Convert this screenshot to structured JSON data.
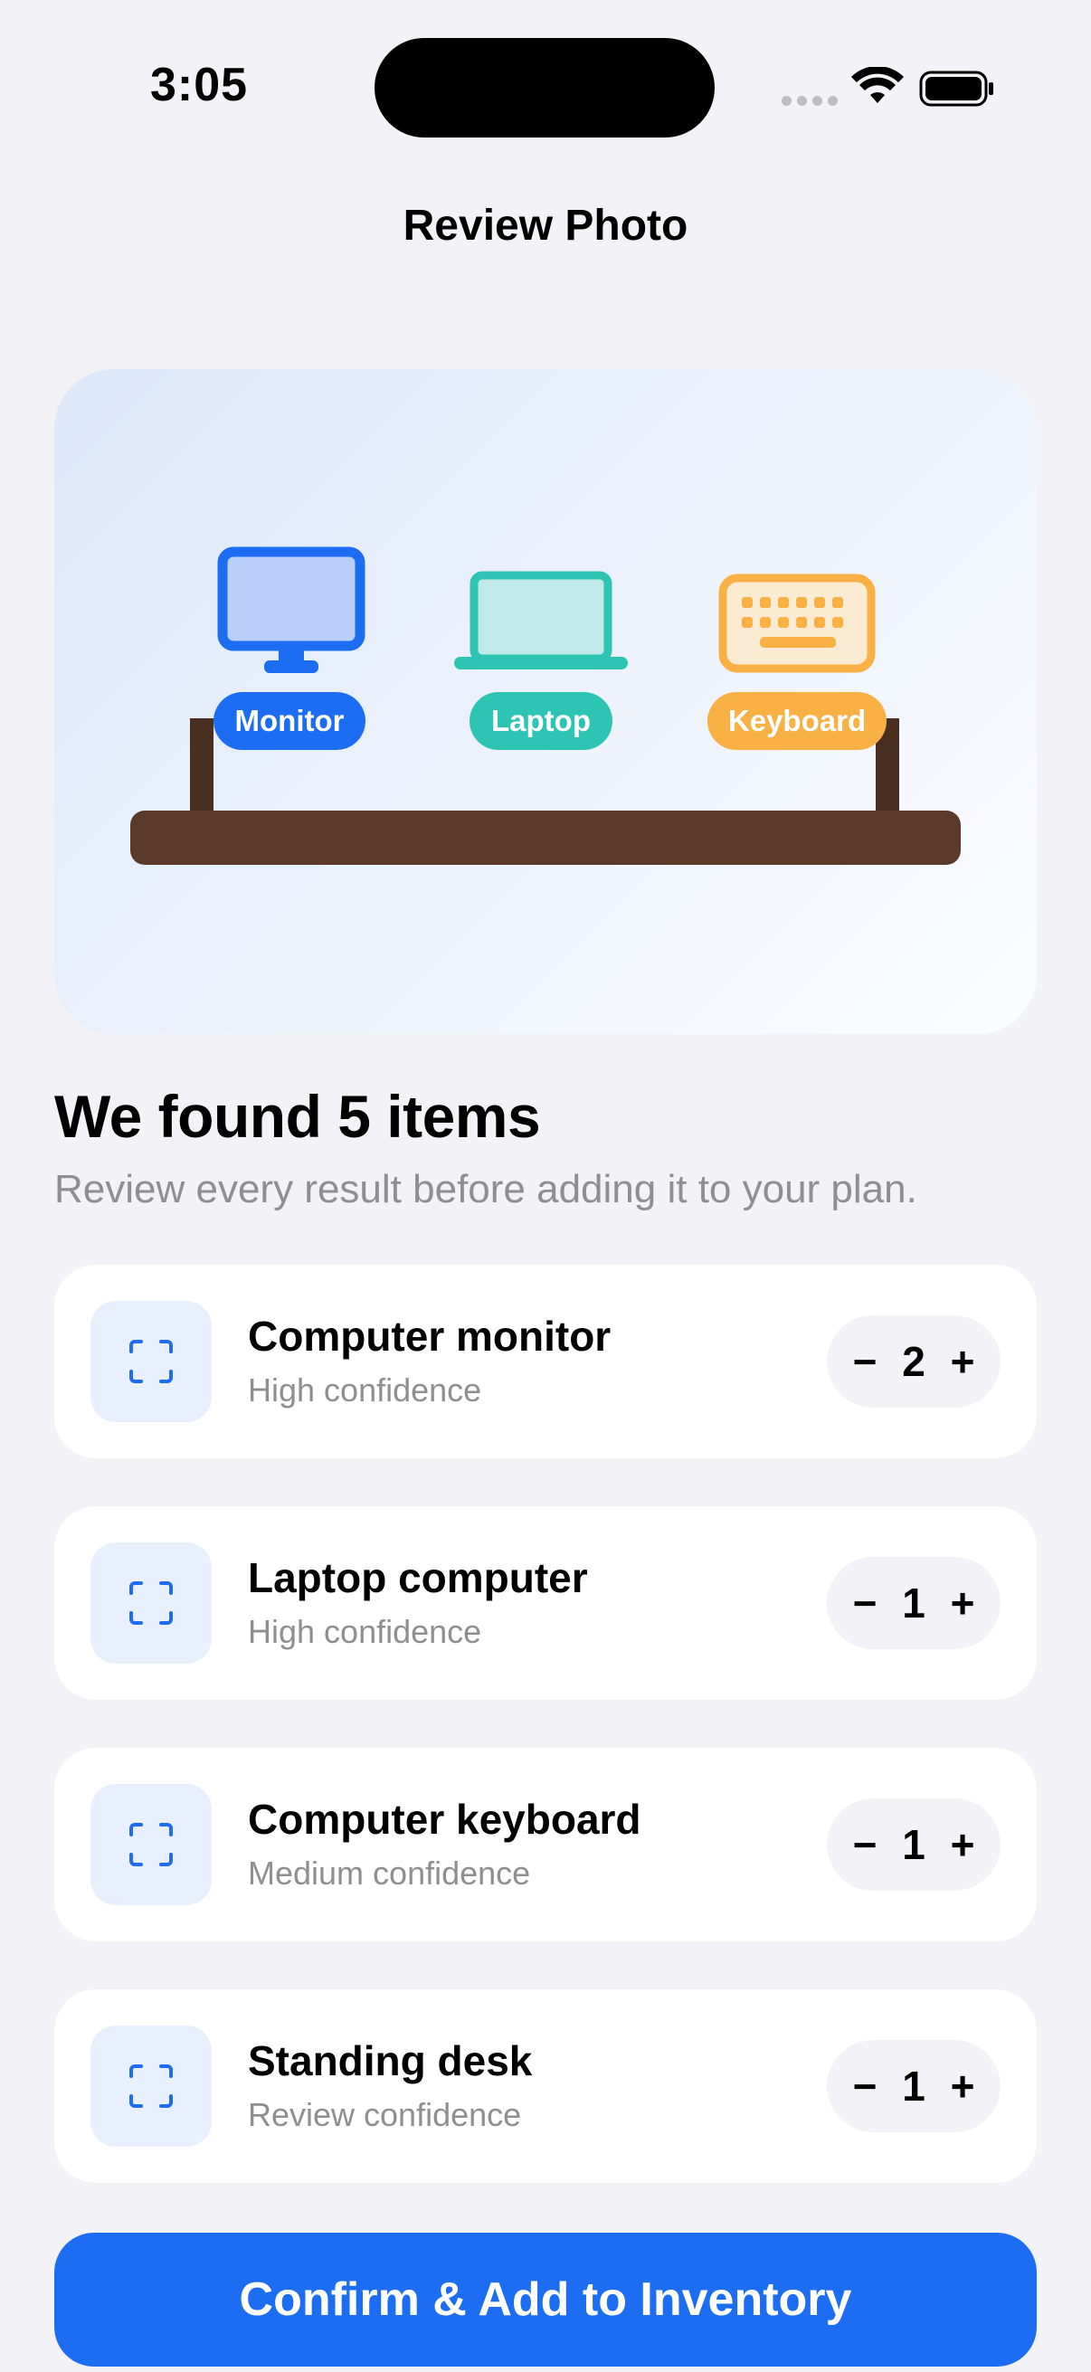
{
  "status_bar": {
    "time": "3:05"
  },
  "nav": {
    "title": "Review Photo"
  },
  "photo": {
    "labels": {
      "monitor": "Monitor",
      "laptop": "Laptop",
      "keyboard": "Keyboard"
    }
  },
  "results": {
    "heading": "We found 5 items",
    "subtitle": "Review every result before adding it to your plan."
  },
  "items": [
    {
      "name": "Computer monitor",
      "confidence": "High confidence",
      "quantity": "2"
    },
    {
      "name": "Laptop computer",
      "confidence": "High confidence",
      "quantity": "1"
    },
    {
      "name": "Computer keyboard",
      "confidence": "Medium confidence",
      "quantity": "1"
    },
    {
      "name": "Standing desk",
      "confidence": "Review confidence",
      "quantity": "1"
    }
  ],
  "stepper": {
    "minus": "−",
    "plus": "+"
  },
  "confirm_button": {
    "label": "Confirm & Add to Inventory"
  },
  "colors": {
    "accent": "#1D6DF2",
    "monitor": "#1D6DF2",
    "laptop": "#2EC4B4",
    "keyboard": "#F9B044",
    "desk": "#5B3A29"
  }
}
